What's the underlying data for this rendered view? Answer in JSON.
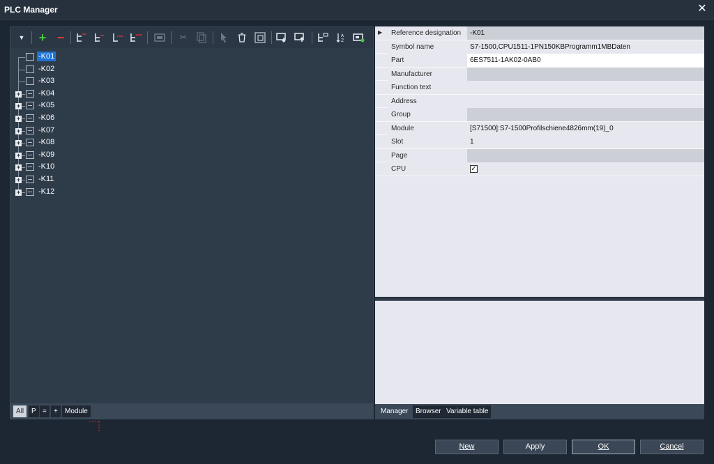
{
  "window": {
    "title": "PLC Manager",
    "close_glyph": "✕"
  },
  "toolbar": {
    "icons": [
      "dropdown-icon",
      "add-icon",
      "remove-icon",
      "tree-insert-icon",
      "tree-insert-sub-icon",
      "tree-move-icon",
      "tree-append-icon",
      "placeholder-icon",
      "cut-icon",
      "copy-icon",
      "select-icon",
      "delete-icon",
      "fullscreen-icon",
      "import-icon",
      "export-icon",
      "tree-config-icon",
      "sort-icon",
      "plc-settings-icon"
    ]
  },
  "tree": {
    "items": [
      {
        "label": "-K01",
        "selected": true,
        "expandable": false
      },
      {
        "label": "-K02",
        "selected": false,
        "expandable": false
      },
      {
        "label": "-K03",
        "selected": false,
        "expandable": false
      },
      {
        "label": "-K04",
        "selected": false,
        "expandable": true
      },
      {
        "label": "-K05",
        "selected": false,
        "expandable": true
      },
      {
        "label": "-K06",
        "selected": false,
        "expandable": true
      },
      {
        "label": "-K07",
        "selected": false,
        "expandable": true
      },
      {
        "label": "-K08",
        "selected": false,
        "expandable": true
      },
      {
        "label": "-K09",
        "selected": false,
        "expandable": true
      },
      {
        "label": "-K10",
        "selected": false,
        "expandable": true
      },
      {
        "label": "-K11",
        "selected": false,
        "expandable": true
      },
      {
        "label": "-K12",
        "selected": false,
        "expandable": true
      }
    ]
  },
  "left_tabs": [
    "All",
    "P",
    "=",
    "+",
    "Module"
  ],
  "properties": [
    {
      "key": "Reference designation",
      "value": "-K01",
      "style": "gray"
    },
    {
      "key": "Symbol name",
      "value": "S7-1500,CPU1511-1PN150KBProgramm1MBDaten",
      "style": "normal"
    },
    {
      "key": "Part",
      "value": "6ES7511-1AK02-0AB0",
      "style": "white"
    },
    {
      "key": "Manufacturer",
      "value": "",
      "style": "gray"
    },
    {
      "key": "Function text",
      "value": "",
      "style": "normal"
    },
    {
      "key": "Address",
      "value": "",
      "style": "normal"
    },
    {
      "key": "Group",
      "value": "",
      "style": "gray"
    },
    {
      "key": "Module",
      "value": "[S71500]:S7-1500Profilschiene4826mm(19)_0",
      "style": "normal"
    },
    {
      "key": "Slot",
      "value": "1",
      "style": "normal"
    },
    {
      "key": "Page",
      "value": "",
      "style": "gray"
    },
    {
      "key": "CPU",
      "value": "",
      "style": "checkbox",
      "checked": true
    }
  ],
  "right_tabs": [
    "Manager",
    "Browser",
    "Variable table"
  ],
  "buttons": {
    "new": "New",
    "apply": "Apply",
    "ok": "OK",
    "cancel": "Cancel"
  },
  "colors": {
    "accent": "#1e73d2",
    "add": "#46c940",
    "remove": "#e33a3a"
  }
}
